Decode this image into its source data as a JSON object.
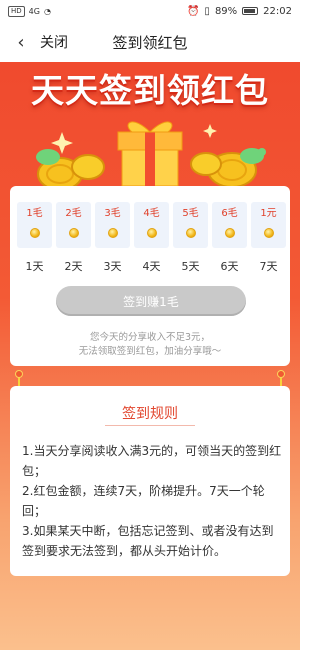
{
  "status": {
    "left": "HD",
    "signal": "4G",
    "battery": "89%",
    "time": "22:02"
  },
  "nav": {
    "close_label": "关闭",
    "title": "签到领红包"
  },
  "hero": {
    "title": "天天签到领红包"
  },
  "days": [
    {
      "amount": "1毛",
      "label": "1天"
    },
    {
      "amount": "2毛",
      "label": "2天"
    },
    {
      "amount": "3毛",
      "label": "3天"
    },
    {
      "amount": "4毛",
      "label": "4天"
    },
    {
      "amount": "5毛",
      "label": "5天"
    },
    {
      "amount": "6毛",
      "label": "6天"
    },
    {
      "amount": "1元",
      "label": "7天"
    }
  ],
  "signin_button": "签到赚1毛",
  "notice": {
    "line1": "您今天的分享收入不足3元，",
    "line2": "无法领取签到红包，加油分享哦～"
  },
  "rules": {
    "title": "签到规则",
    "items": [
      "1.当天分享阅读收入满3元的，可领当天的签到红包；",
      "2.红包金额，连续7天，阶梯提升。7天一个轮回；",
      "3.如果某天中断，包括忘记签到、或者没有达到签到要求无法签到，都从头开始计价。"
    ]
  }
}
